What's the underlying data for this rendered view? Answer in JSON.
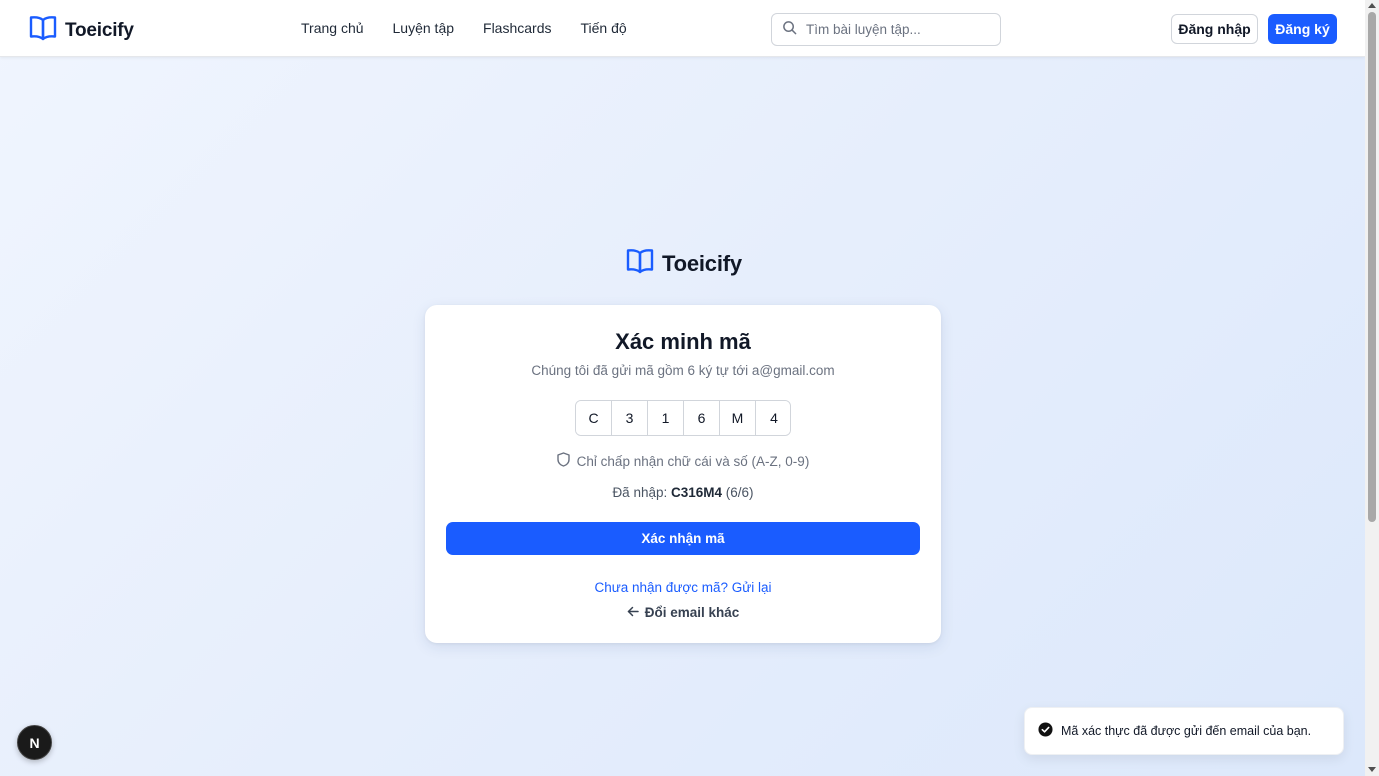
{
  "header": {
    "brand": "Toeicify",
    "nav": [
      "Trang chủ",
      "Luyện tập",
      "Flashcards",
      "Tiến độ"
    ],
    "search_placeholder": "Tìm bài luyện tập...",
    "login_label": "Đăng nhập",
    "register_label": "Đăng ký"
  },
  "center_logo": {
    "brand": "Toeicify"
  },
  "verify": {
    "title": "Xác minh mã",
    "subtitle": "Chúng tôi đã gửi mã gồm 6 ký tự tới a@gmail.com",
    "code": [
      "C",
      "3",
      "1",
      "6",
      "M",
      "4"
    ],
    "hint": "Chỉ chấp nhận chữ cái và số (A-Z, 0-9)",
    "entered_label": "Đã nhập:",
    "entered_value": "C316M4",
    "entered_count": "(6/6)",
    "confirm_label": "Xác nhận mã",
    "resend_label": "Chưa nhận được mã? Gửi lại",
    "change_email_label": "Đổi email khác"
  },
  "toast": {
    "message": "Mã xác thực đã được gửi đến email của bạn."
  },
  "dev_badge": {
    "letter": "N"
  },
  "colors": {
    "primary": "#1a5cff",
    "text": "#111827",
    "muted": "#6b7280"
  },
  "icons": {
    "brand": "book-open-icon",
    "search": "search-icon",
    "shield": "shield-icon",
    "back": "arrow-left-icon",
    "toast": "check-circle-icon"
  }
}
